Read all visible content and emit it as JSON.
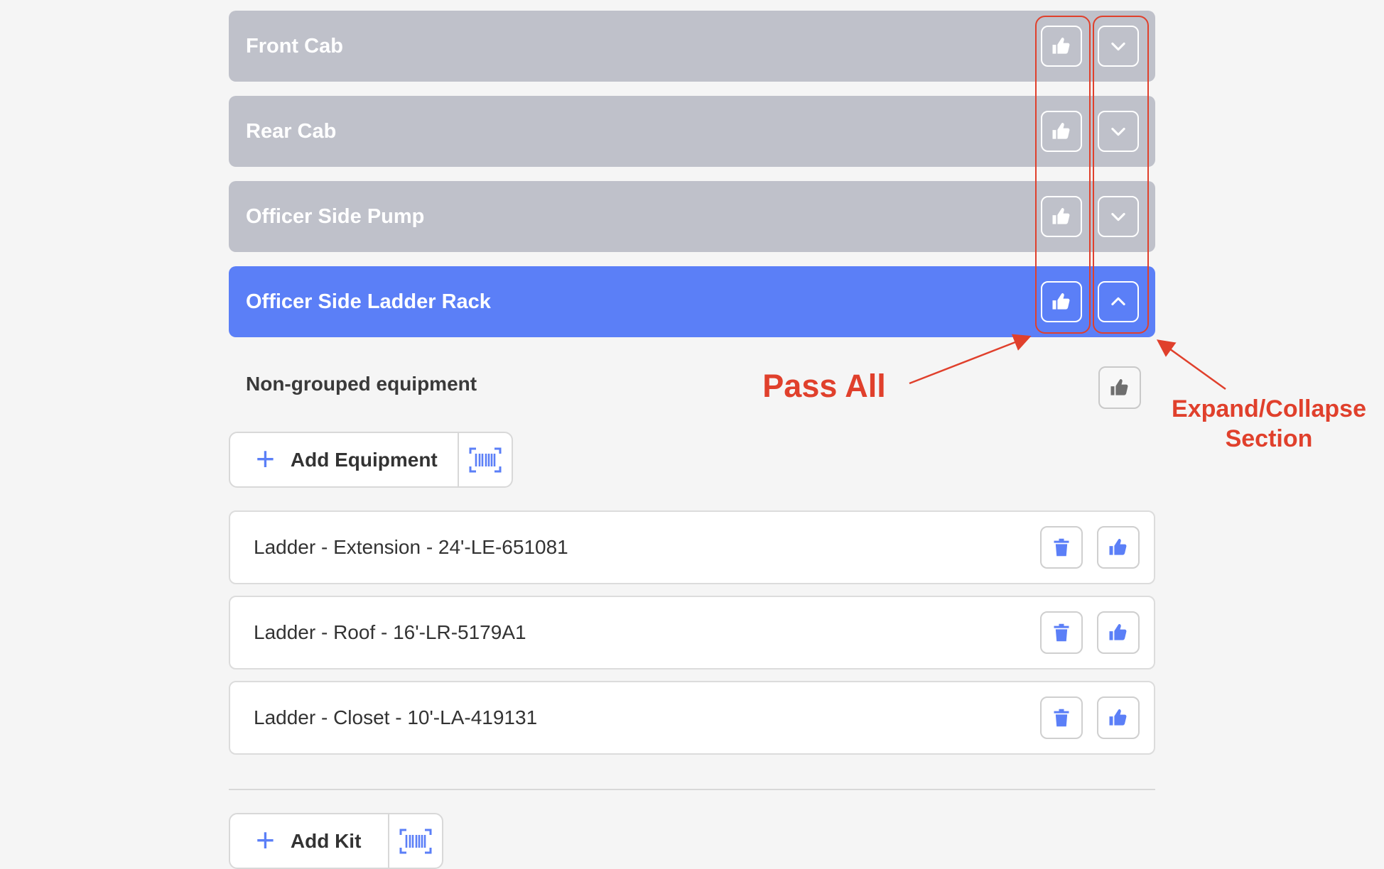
{
  "sections": [
    {
      "title": "Front Cab",
      "expanded": false
    },
    {
      "title": "Rear Cab",
      "expanded": false
    },
    {
      "title": "Officer Side Pump",
      "expanded": false
    },
    {
      "title": "Officer Side Ladder Rack",
      "expanded": true
    }
  ],
  "non_grouped": {
    "label": "Non-grouped equipment"
  },
  "add_equipment": {
    "label": "Add Equipment"
  },
  "equipment": [
    {
      "label": "Ladder - Extension - 24'-LE-651081"
    },
    {
      "label": "Ladder - Roof - 16'-LR-5179A1"
    },
    {
      "label": "Ladder - Closet - 10'-LA-419131"
    }
  ],
  "add_kit": {
    "label": "Add Kit"
  },
  "annotations": {
    "pass_all": "Pass All",
    "expand_collapse_line1": "Expand/Collapse",
    "expand_collapse_line2": "Section"
  },
  "colors": {
    "section_inactive": "#bfc1ca",
    "section_active": "#5b7ff7",
    "accent": "#5b7ff7",
    "annotation": "#e0402c"
  }
}
